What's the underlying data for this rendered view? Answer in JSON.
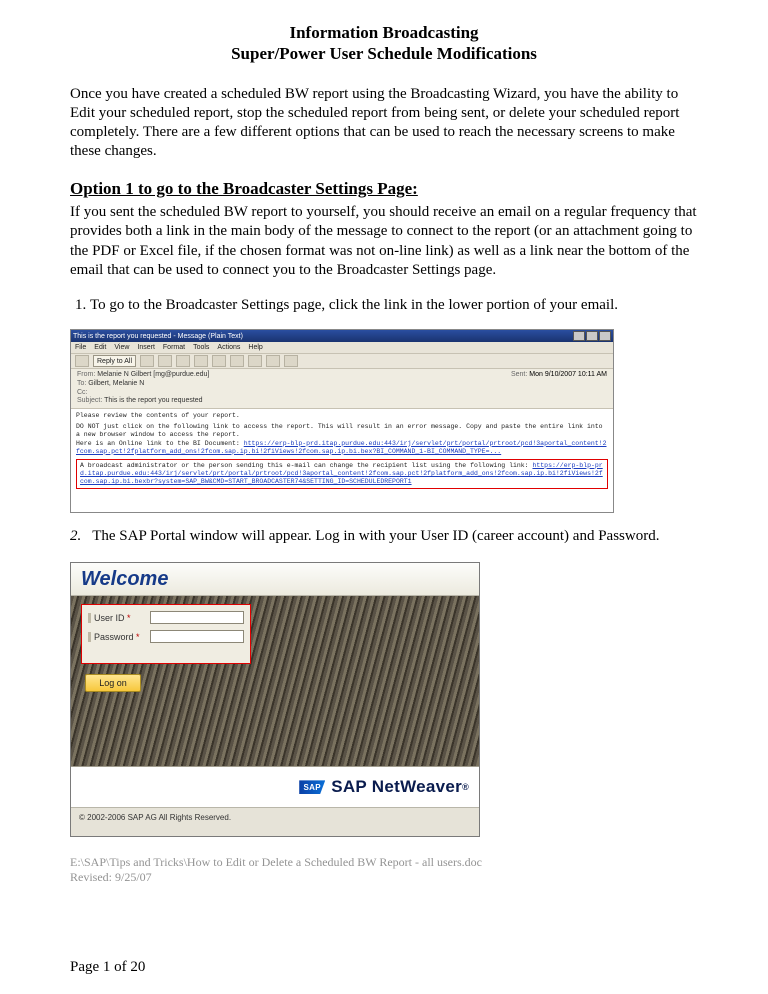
{
  "title_line1": "Information Broadcasting",
  "title_line2": "Super/Power User Schedule Modifications",
  "intro": "Once you have created a scheduled BW report using the Broadcasting Wizard, you have the ability to Edit your scheduled report, stop the scheduled report from being sent, or delete your scheduled report completely.  There are a few different options that can be used to reach the necessary screens to make these changes.",
  "option1_heading": "Option 1 to go to the Broadcaster Settings Page:",
  "option1_para": "If you sent the scheduled BW report to yourself, you should receive an email on a regular frequency that provides both a link in the main body of the message to connect to the report (or an attachment going to the PDF or Excel file, if the chosen format was not on-line link) as well as a link near the bottom of the email that can be used to connect you to the Broadcaster Settings page.",
  "step1": "To go to the Broadcaster Settings page, click the link in the lower portion of your email.",
  "email": {
    "window_title": "This is the report you requested - Message (Plain Text)",
    "menu": [
      "File",
      "Edit",
      "View",
      "Insert",
      "Format",
      "Tools",
      "Actions",
      "Help"
    ],
    "reply_label": "Reply to All",
    "from_label": "From:",
    "from_value": "Melanie N Gilbert [mg@purdue.edu]",
    "sent_label": "Sent:",
    "sent_value": "Mon 9/10/2007 10:11 AM",
    "to_label": "To:",
    "to_value": "Gilbert, Melanie N",
    "cc_label": "Cc:",
    "subject_label": "Subject:",
    "subject_value": "This is the report you requested",
    "body_line1": "Please review the contents of your report.",
    "body_line2": "DO NOT just click on the following link to access the report.  This will result in an error message.  Copy and paste the entire link into a new browser window to access the report.",
    "body_line3_label": "Here is an Online link to the BI Document:",
    "body_link1": "https://erp-blp-prd.itap.purdue.edu:443/irj/servlet/prt/portal/prtroot/pcd!3aportal_content!2fcom.sap.pct!2fplatform_add_ons!2fcom.sap.ip.bi!2fiViews!2fcom.sap.ip.bi.bex?BI_COMMAND_1-BI_COMMAND_TYPE=...",
    "redbox_text": "A broadcast administrator or the person sending this e-mail can change the recipient list using the following link:",
    "redbox_link": "https://erp-blp-prd.itap.purdue.edu:443/irj/servlet/prt/portal/prtroot/pcd!3aportal_content!2fcom.sap.pct!2fplatform_add_ons!2fcom.sap.ip.bi!2fiViews!2fcom.sap.ip.bi.bexbr?system=SAP_BW&CMD=START_BROADCASTER74&SETTING_ID=SCHEDULEDREPORT1"
  },
  "step2_prefix": "2.",
  "step2": "The SAP Portal window will appear.  Log in with your User ID (career account) and Password.",
  "login": {
    "welcome": "Welcome",
    "user_label": "User ID",
    "pass_label": "Password",
    "req_marker": "*",
    "logon": "Log on",
    "brand": "SAP NetWeaver",
    "brand_reg": "®",
    "sap_logo_text": "SAP",
    "copyright": "© 2002-2006 SAP AG All Rights Reserved."
  },
  "footer_path": "E:\\SAP\\Tips and Tricks\\How to Edit or Delete a Scheduled BW Report - all users.doc",
  "footer_revised": "Revised: 9/25/07",
  "page_number": "Page 1 of 20"
}
